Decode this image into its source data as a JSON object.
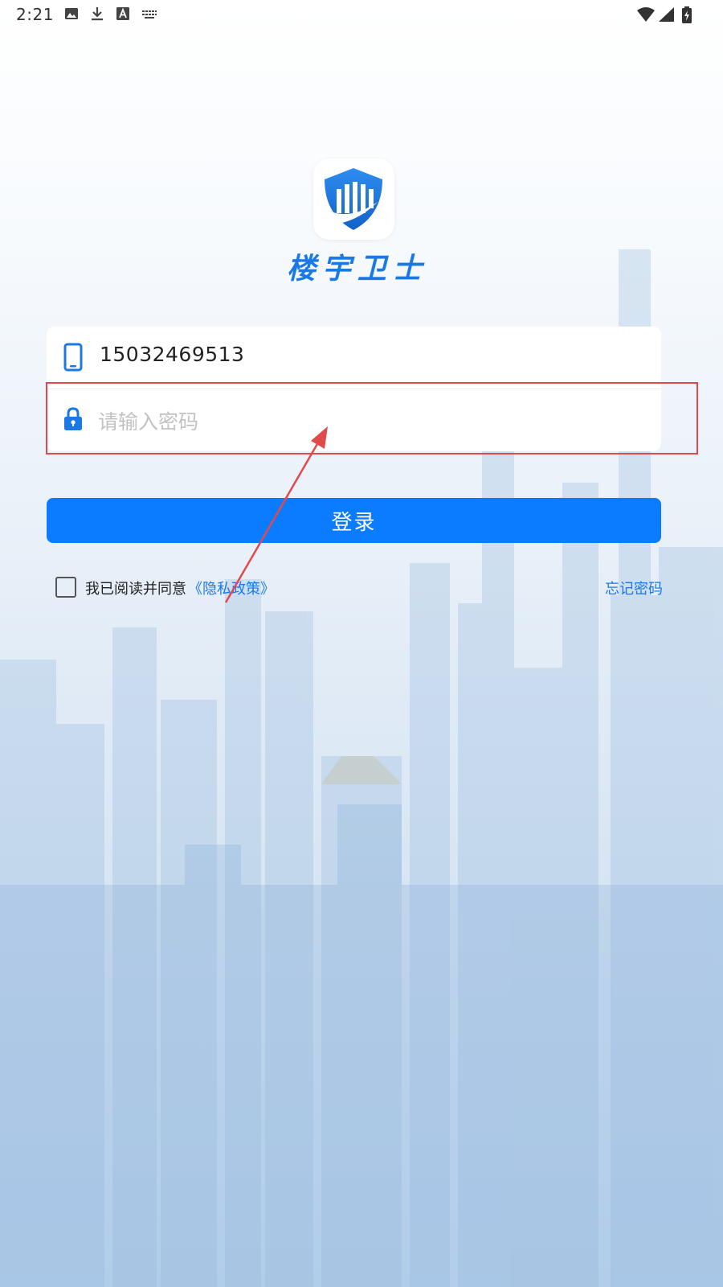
{
  "status_bar": {
    "time": "2:21",
    "left_icons": [
      "image-icon",
      "download-icon",
      "font-icon",
      "keyboard-icon"
    ],
    "right_icons": [
      "wifi-icon",
      "signal-icon",
      "battery-charging-icon"
    ]
  },
  "app": {
    "name": "楼宇卫士",
    "logo_icon": "shield-building-logo-icon",
    "brand_color": "#1b79e6"
  },
  "form": {
    "phone_icon": "phone-icon",
    "phone_value": "15032469513",
    "password_icon": "lock-icon",
    "password_placeholder": "请输入密码",
    "login_label": "登录",
    "login_color": "#0b7bff"
  },
  "agreement": {
    "checked": false,
    "text": "我已阅读并同意",
    "privacy_link": "《隐私政策》",
    "forgot_password": "忘记密码"
  },
  "annotation": {
    "color": "#e14a4a"
  }
}
